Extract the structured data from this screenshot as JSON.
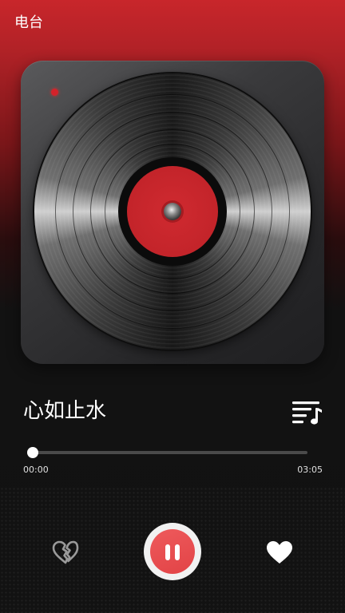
{
  "header": {
    "title": "电台"
  },
  "player": {
    "song_title": "心如止水",
    "progress_fraction": 0.0,
    "time_current": "00:00",
    "time_total": "03:05",
    "state": "playing"
  },
  "icons": {
    "playlist": "playlist-icon",
    "dislike": "broken-heart-icon",
    "pause": "pause-icon",
    "like": "heart-icon",
    "power_indicator": "power-indicator-icon"
  },
  "colors": {
    "accent": "#e24346",
    "header_red": "#c8262b",
    "background": "#121212",
    "text": "#ffffff"
  }
}
